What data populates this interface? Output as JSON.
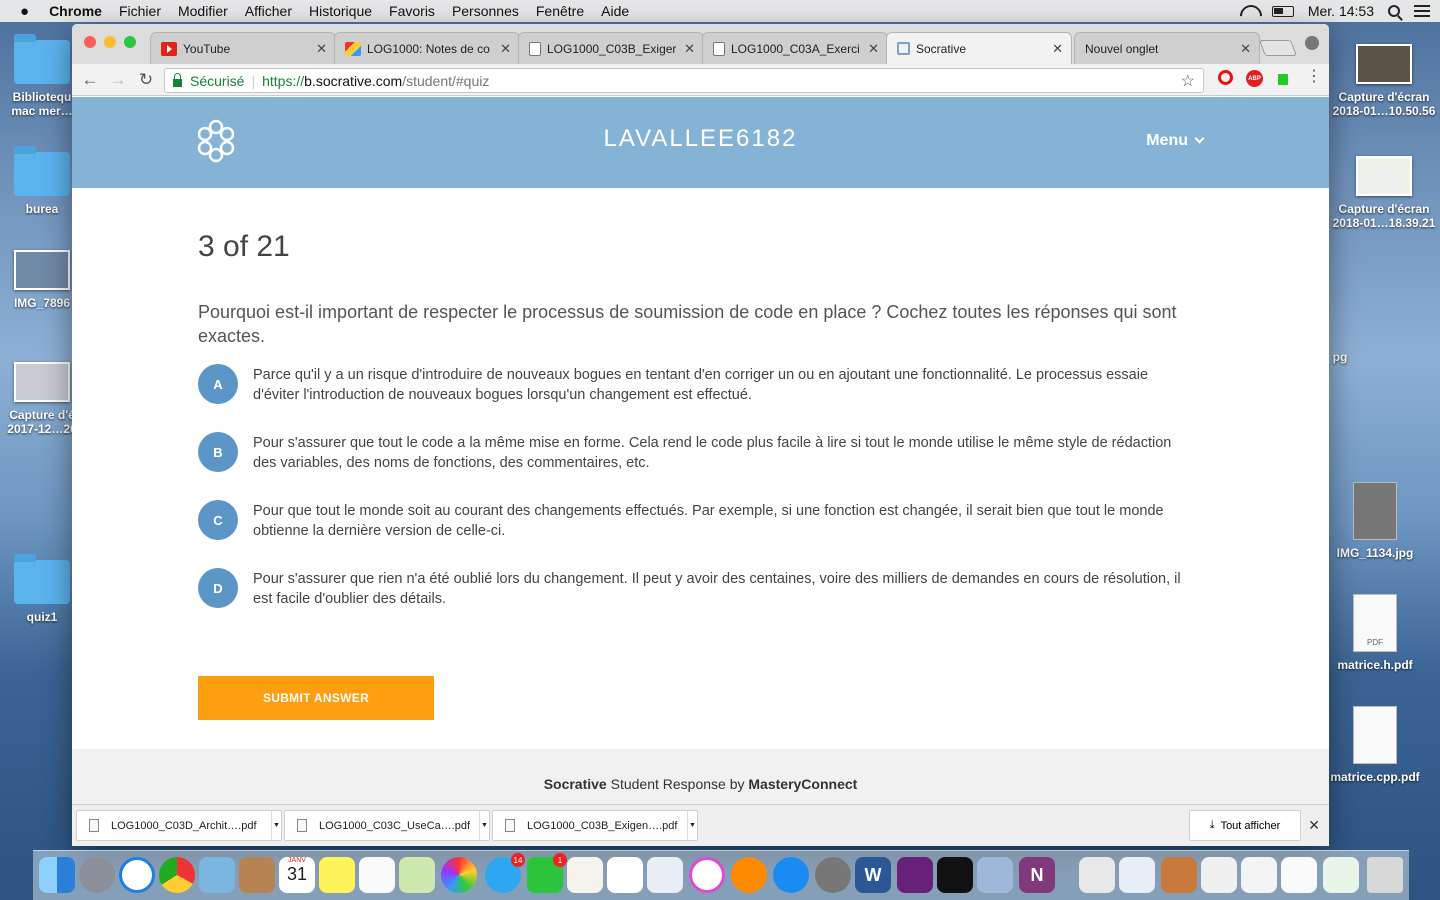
{
  "menubar": {
    "apple": "",
    "items": [
      "Chrome",
      "Fichier",
      "Modifier",
      "Afficher",
      "Historique",
      "Favoris",
      "Personnes",
      "Fenêtre",
      "Aide"
    ],
    "clock": "Mer. 14:53"
  },
  "desktop": {
    "left": [
      {
        "label": "Bibliotequ\nmac mer…"
      },
      {
        "label": "burea"
      },
      {
        "label": "IMG_7896"
      },
      {
        "label": "Capture d'é\n2017-12…20"
      },
      {
        "label": "quiz1"
      }
    ],
    "right": [
      {
        "label": "Capture d'écran\n2018-01…10.50.56"
      },
      {
        "label": "Capture d'écran\n2018-01…18.39.21"
      },
      {
        "label": "pg"
      },
      {
        "label": "IMG_1134.jpg"
      },
      {
        "label": "matrice.h.pdf",
        "doc_tag": "PDF"
      },
      {
        "label": "matrice.cpp.pdf"
      }
    ]
  },
  "tabs": [
    {
      "title": "YouTube",
      "icon": "youtube-icon"
    },
    {
      "title": "LOG1000: Notes de co",
      "icon": "log1000-icon"
    },
    {
      "title": "LOG1000_C03B_Exiger",
      "icon": "document-icon"
    },
    {
      "title": "LOG1000_C03A_Exerci",
      "icon": "document-icon"
    },
    {
      "title": "Socrative",
      "icon": "socrative-icon",
      "active": true
    },
    {
      "title": "Nouvel onglet",
      "icon": ""
    }
  ],
  "omnibox": {
    "secure_label": "Sécurisé",
    "protocol": "https://",
    "host": "b.socrative.com",
    "path": "/student/#quiz"
  },
  "extensions": {
    "abp_label": "ABP"
  },
  "socrative": {
    "room_name": "LAVALLEE6182",
    "menu_label": "Menu",
    "progress": "3 of 21",
    "question": "Pourquoi est-il important de respecter le processus de soumission de code en place ? Cochez toutes les réponses qui sont exactes.",
    "answers": [
      {
        "letter": "A",
        "text": "Parce qu'il y a un risque d'introduire de nouveaux bogues en tentant d'en corriger un ou en ajoutant une fonctionnalité. Le processus essaie d'éviter l'introduction de nouveaux bogues lorsqu'un changement est effectué."
      },
      {
        "letter": "B",
        "text": "Pour s'assurer que tout le code a la même mise en forme. Cela rend le code plus facile à lire si tout le monde utilise le même style de rédaction des variables, des noms de fonctions, des commentaires, etc."
      },
      {
        "letter": "C",
        "text": "Pour que tout le monde soit au courant des changements effectués. Par exemple, si une fonction est changée, il serait bien que tout le monde obtienne la dernière version de celle-ci."
      },
      {
        "letter": "D",
        "text": "Pour s'assurer que rien n'a été oublié lors du changement. Il peut y avoir des centaines, voire des milliers de demandes en cours de résolution, il est facile d'oublier des détails."
      }
    ],
    "submit_label": "SUBMIT ANSWER",
    "footer": {
      "brand": "Socrative",
      "middle": " Student Response by ",
      "company": "MasteryConnect"
    }
  },
  "downloads": {
    "items": [
      "LOG1000_C03D_Archit….pdf",
      "LOG1000_C03C_UseCa….pdf",
      "LOG1000_C03B_Exigen….pdf"
    ],
    "show_all": "Tout afficher"
  },
  "dock": {
    "calendar_month": "JANV",
    "calendar_day": "31",
    "badge_messages": "14",
    "badge_facetime": "1",
    "word_letter": "W",
    "onenote_letter": "N"
  },
  "colors": {
    "socrative_header": "#84b3d6",
    "answer_circle": "#5b96c7",
    "submit_button": "#ff9f0f"
  }
}
